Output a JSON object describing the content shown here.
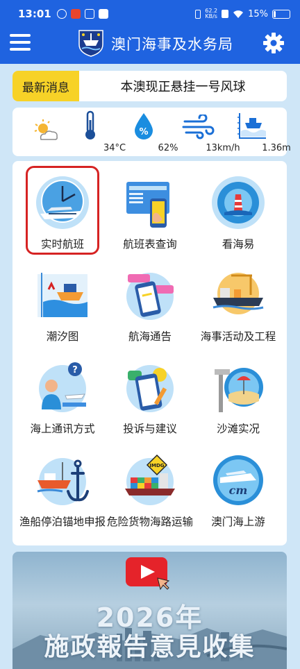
{
  "status_bar": {
    "time": "13:01",
    "net_speed_value": "62.2",
    "net_speed_unit": "KB/s",
    "battery": "15%",
    "battery_level": 0.15
  },
  "header": {
    "title": "澳门海事及水务局",
    "menu_icon": "hamburger-menu-icon",
    "settings_icon": "gear-icon"
  },
  "news": {
    "tag": "最新消息",
    "message": "本澳现正悬挂一号风球"
  },
  "weather": [
    {
      "icon": "partly-cloudy-icon",
      "value": ""
    },
    {
      "icon": "thermometer-icon",
      "value": "34°C"
    },
    {
      "icon": "humidity-drop-icon",
      "value": "62%"
    },
    {
      "icon": "wind-icon",
      "value": "13km/h"
    },
    {
      "icon": "tide-level-icon",
      "value": "1.36m"
    }
  ],
  "services": [
    {
      "label": "实时航班",
      "icon": "ferry-clock-icon"
    },
    {
      "label": "航班表查询",
      "icon": "schedule-phone-icon"
    },
    {
      "label": "看海易",
      "icon": "camera-lighthouse-icon"
    },
    {
      "label": "潮汐图",
      "icon": "tide-chart-icon"
    },
    {
      "label": "航海通告",
      "icon": "notice-phone-icon"
    },
    {
      "label": "海事活动及工程",
      "icon": "marine-works-icon"
    },
    {
      "label": "海上通讯方式",
      "icon": "telephone-support-icon"
    },
    {
      "label": "投诉与建议",
      "icon": "complaint-feedback-icon"
    },
    {
      "label": "沙滩实况",
      "icon": "beach-camera-icon"
    },
    {
      "label": "渔船停泊锚地申报",
      "icon": "fishing-boat-anchor-icon"
    },
    {
      "label": "危险货物海路运输",
      "icon": "cargo-ship-imdg-icon"
    },
    {
      "label": "澳门海上游",
      "icon": "cruise-boat-icon"
    }
  ],
  "imdg_badge": "IMDG",
  "cm_text": "cm",
  "banner": {
    "year": "2026年",
    "subtitle": "施政報告意見收集",
    "play_icon": "video-play-icon"
  },
  "colors": {
    "primary": "#1f63e0",
    "news_tag": "#f7d227",
    "highlight": "#d62323",
    "background": "#cfe6f7"
  }
}
